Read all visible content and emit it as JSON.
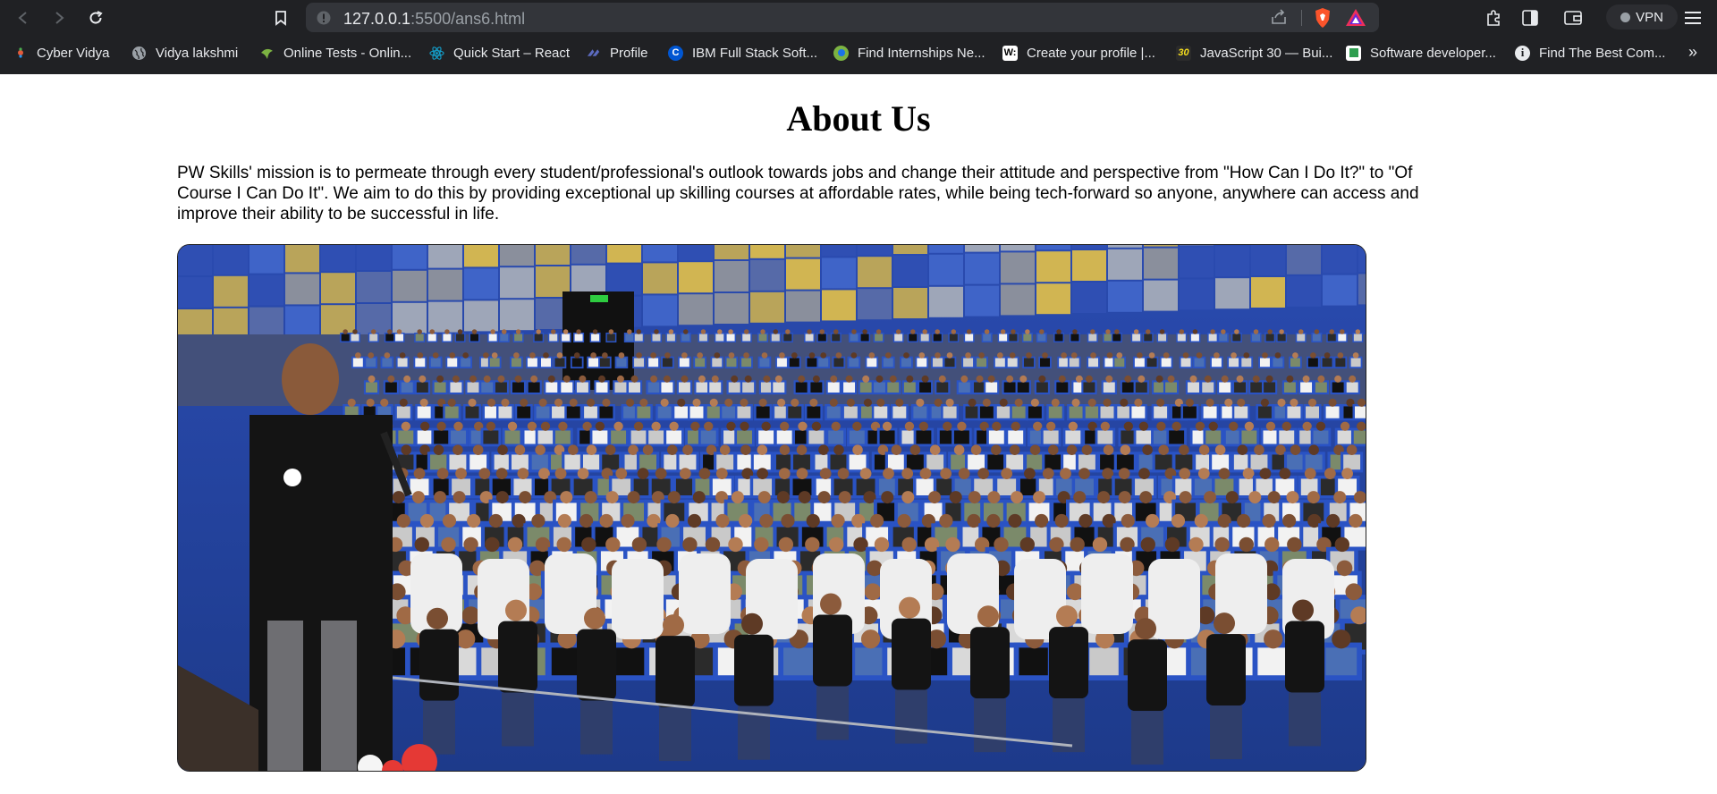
{
  "browser": {
    "url_host": "127.0.0.1",
    "url_path": ":5500/ans6.html",
    "vpn_label": "VPN",
    "bookmarks": [
      {
        "label": "Cyber Vidya",
        "icon": "cyber-vidya-icon"
      },
      {
        "label": "Vidya lakshmi",
        "icon": "globe-icon"
      },
      {
        "label": "Online Tests - Onlin...",
        "icon": "online-tests-icon"
      },
      {
        "label": "Quick Start – React",
        "icon": "react-icon"
      },
      {
        "label": "Profile",
        "icon": "profile-icon"
      },
      {
        "label": "IBM Full Stack Soft...",
        "icon": "coursera-icon"
      },
      {
        "label": "Find Internships Ne...",
        "icon": "internshala-icon"
      },
      {
        "label": "Create your profile |...",
        "icon": "wellfound-icon"
      },
      {
        "label": "JavaScript 30 — Bui...",
        "icon": "javascript30-icon"
      },
      {
        "label": "Software developer...",
        "icon": "jobs-icon"
      },
      {
        "label": "Find The Best Com...",
        "icon": "info-icon"
      }
    ],
    "bookmarks_overflow": "»"
  },
  "page": {
    "title": "About Us",
    "mission": "PW Skills' mission is to permeate through every student/professional's outlook towards jobs and change their attitude and perspective from \"How Can I Do It?\" to \"Of Course I Can Do It\". We aim to do this by providing exceptional up skilling courses at affordable rates, while being tech-forward so anyone, anywhere can access and improve their ability to be successful in life."
  }
}
